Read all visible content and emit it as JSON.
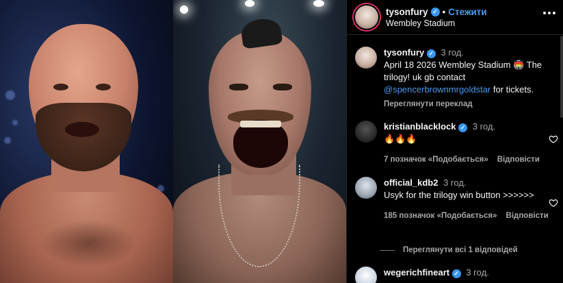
{
  "header": {
    "username": "tysonfury",
    "separator": "•",
    "follow_label": "Стежити",
    "location": "Wembley Stadium"
  },
  "caption": {
    "username": "tysonfury",
    "time": "3 год.",
    "text_before": "April 18 2026 Wembley Stadium 🏟️ The trilogy! uk gb contact ",
    "mention": "@spencerbrownmrgoldstar",
    "text_after": " for tickets.",
    "translate_label": "Переглянути переклад"
  },
  "comments": [
    {
      "username": "kristianblacklock",
      "verified": true,
      "time": "3 год.",
      "text": "🔥🔥🔥",
      "likes": "7 позначок «Подобається»",
      "reply_label": "Відповісти"
    },
    {
      "username": "official_kdb2",
      "verified": false,
      "time": "3 год.",
      "text": "Usyk for the trilogy win button >>>>>>",
      "likes": "185 позначок «Подобається»",
      "reply_label": "Відповісти",
      "replies_label": "Переглянути всі 1 відповідей"
    },
    {
      "username": "wegerichfineart",
      "verified": true,
      "time": "3 год.",
      "text": ""
    }
  ],
  "colors": {
    "link": "#4c9bf0",
    "verified": "#3897f0",
    "muted": "#a8a8a8",
    "background": "#000000"
  },
  "icons": [
    "more-options-icon",
    "verified-badge-icon",
    "heart-icon"
  ]
}
